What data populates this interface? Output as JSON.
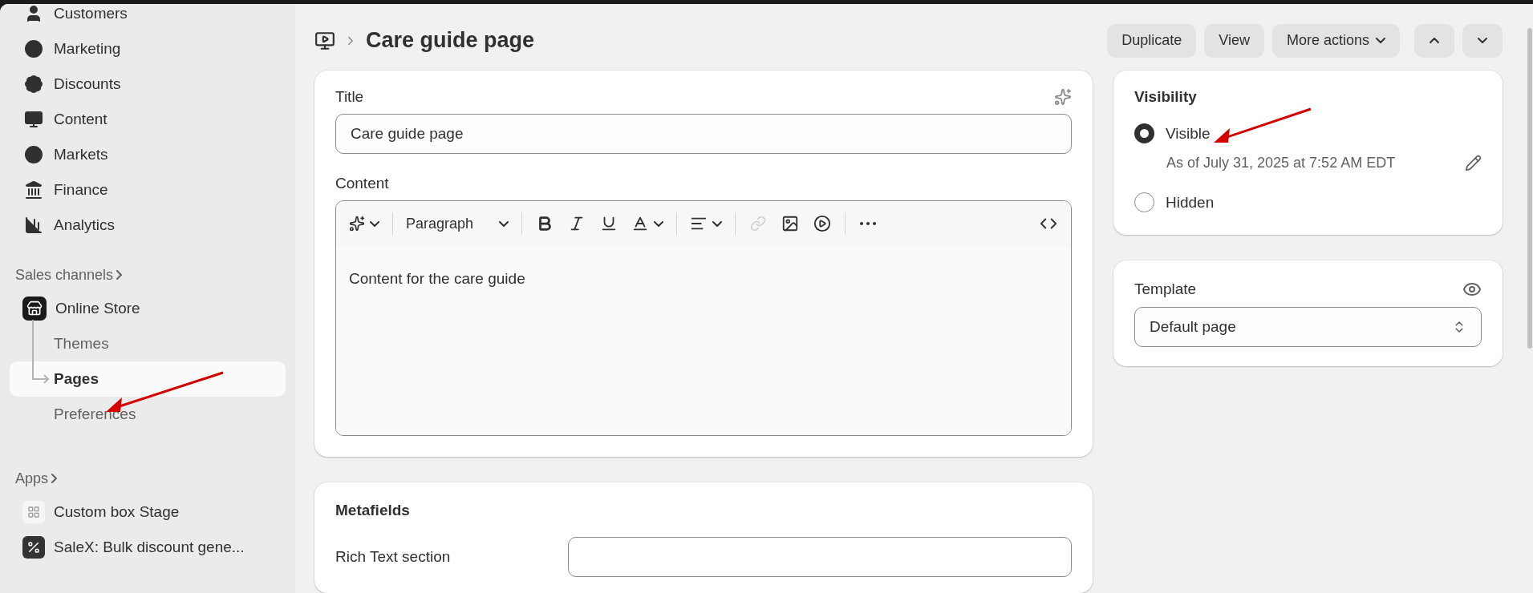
{
  "sidebar": {
    "items": [
      {
        "label": "Customers",
        "selected": false
      },
      {
        "label": "Marketing",
        "selected": false
      },
      {
        "label": "Discounts",
        "selected": false
      },
      {
        "label": "Content",
        "selected": false
      },
      {
        "label": "Markets",
        "selected": false
      },
      {
        "label": "Finance",
        "selected": false
      },
      {
        "label": "Analytics",
        "selected": false
      }
    ],
    "sales_channels": {
      "heading": "Sales channels",
      "items": [
        {
          "label": "Online Store",
          "children": [
            {
              "label": "Themes",
              "selected": false
            },
            {
              "label": "Pages",
              "selected": true
            },
            {
              "label": "Preferences",
              "selected": false
            }
          ]
        }
      ]
    },
    "apps": {
      "heading": "Apps",
      "items": [
        {
          "label": "Custom box Stage"
        },
        {
          "label": "SaleX: Bulk discount gene..."
        }
      ]
    }
  },
  "header": {
    "title": "Care guide page",
    "actions": [
      "Duplicate",
      "View",
      "More actions"
    ]
  },
  "title_field": {
    "label": "Title",
    "value": "Care guide page"
  },
  "content": {
    "label": "Content",
    "toolbar": [
      [
        {
          "kind": "ai",
          "disabled": false
        }
      ],
      [
        {
          "kind": "format",
          "label": "Paragraph",
          "disabled": false
        }
      ],
      [
        {
          "kind": "bold",
          "disabled": false
        },
        {
          "kind": "italic",
          "disabled": false
        },
        {
          "kind": "underline",
          "disabled": false
        },
        {
          "kind": "color",
          "disabled": false
        }
      ],
      [
        {
          "kind": "align",
          "disabled": false
        }
      ],
      [
        {
          "kind": "link",
          "disabled": true
        },
        {
          "kind": "image",
          "disabled": false
        },
        {
          "kind": "video",
          "disabled": false
        }
      ],
      [
        {
          "kind": "more",
          "disabled": false
        },
        {
          "kind": "code",
          "disabled": false
        }
      ]
    ],
    "body": "Content for the care guide"
  },
  "metafields": {
    "heading": "Metafields",
    "fields": [
      {
        "label": "Rich Text section"
      }
    ]
  },
  "visibility": {
    "heading": "Visibility",
    "options": [
      {
        "label": "Visible",
        "selected": true,
        "note": "As of July 31, 2025 at 7:52 AM EDT"
      },
      {
        "label": "Hidden",
        "selected": false
      }
    ]
  },
  "template": {
    "label": "Template",
    "value": "Default page"
  }
}
